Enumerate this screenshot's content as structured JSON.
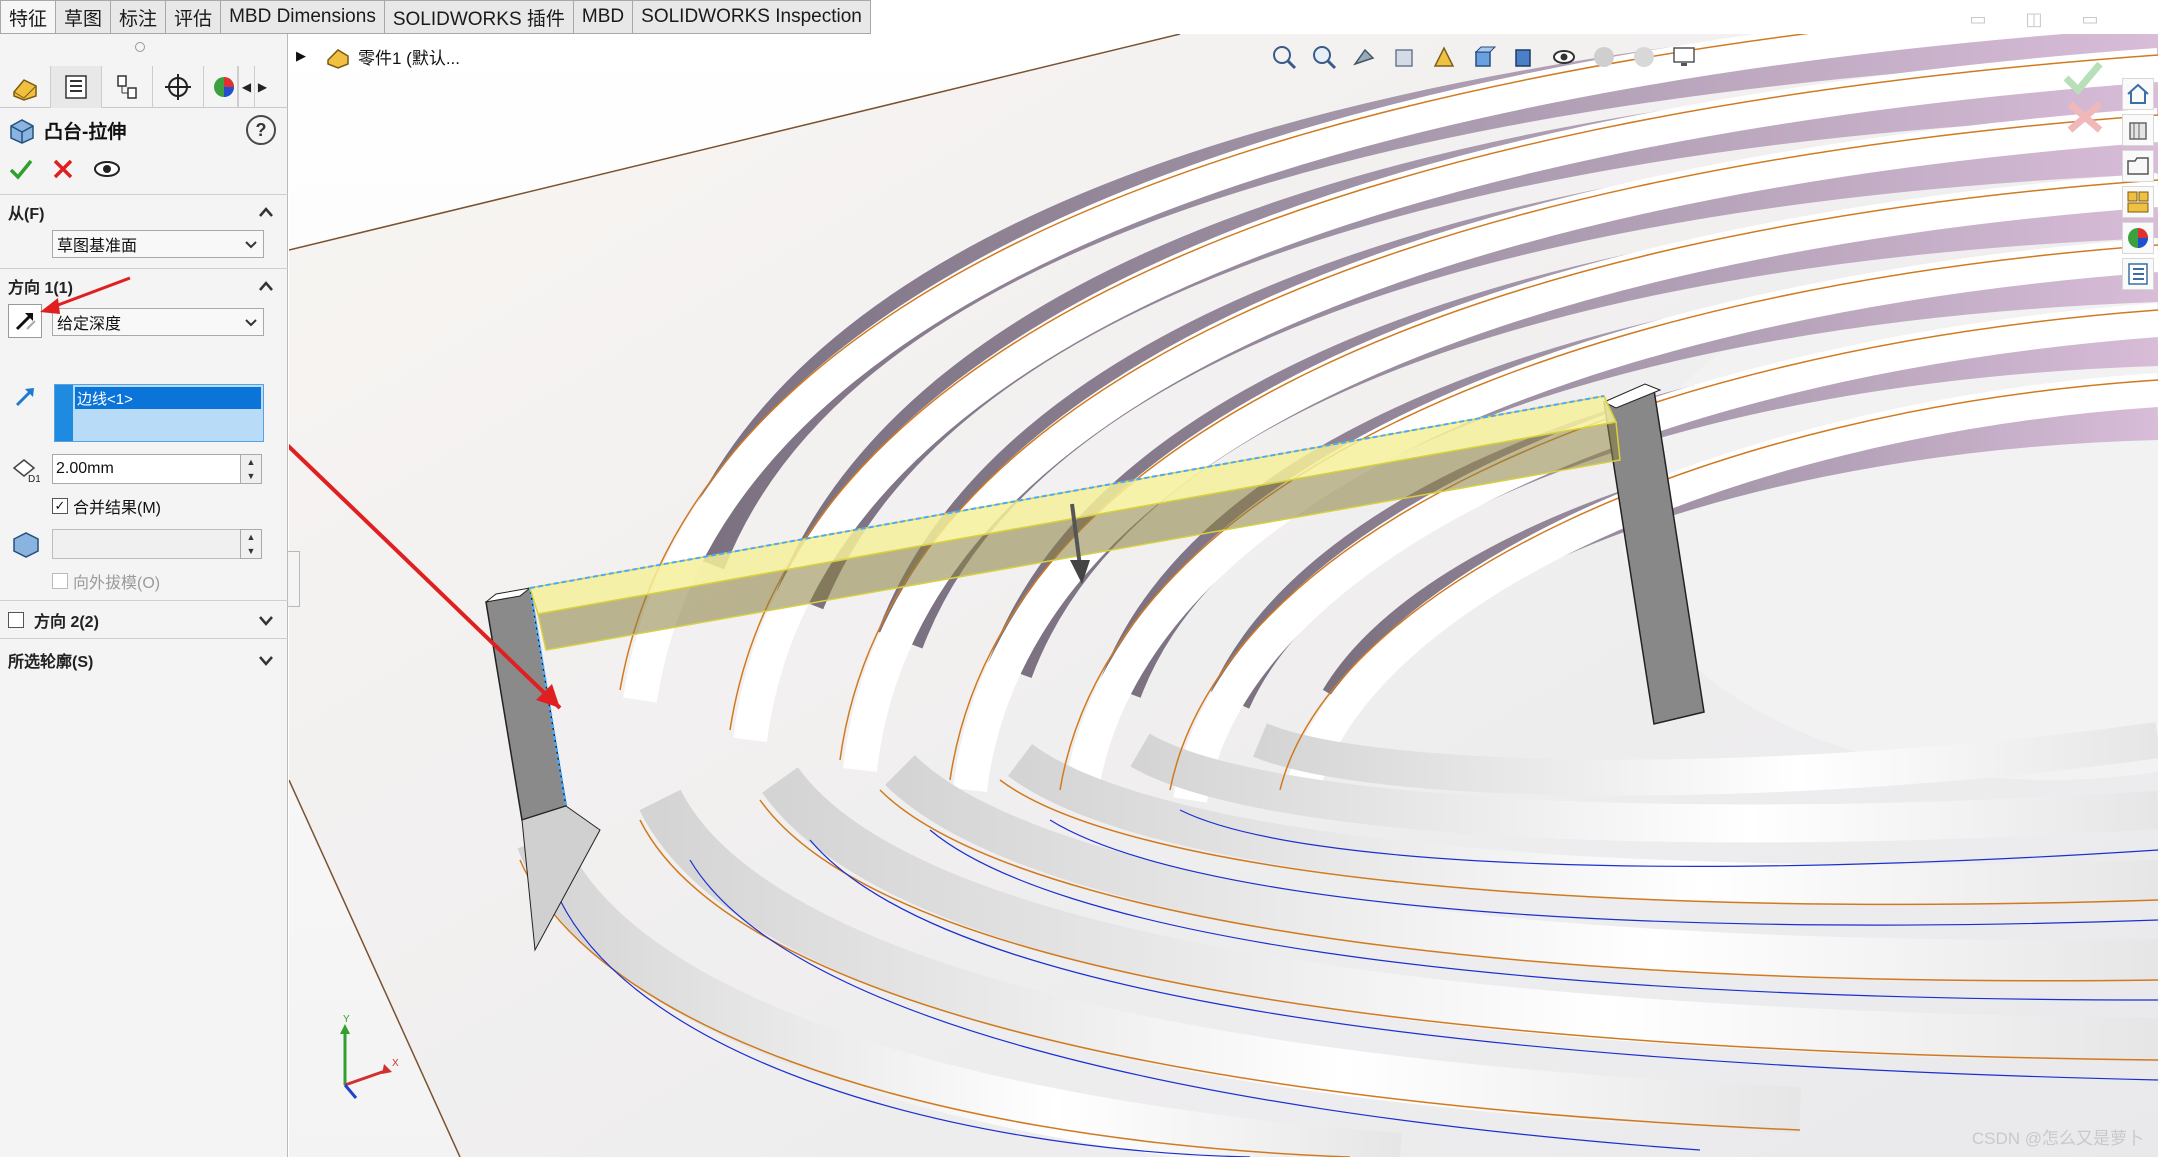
{
  "tabs": [
    "特征",
    "草图",
    "标注",
    "评估",
    "MBD Dimensions",
    "SOLIDWORKS 插件",
    "MBD",
    "SOLIDWORKS Inspection"
  ],
  "feature": {
    "title": "凸台-拉伸",
    "help": "?"
  },
  "sections": {
    "from": {
      "label": "从(F)",
      "value": "草图基准面"
    },
    "dir1": {
      "label": "方向 1(1)",
      "end_condition": "给定深度",
      "selection": "边线<1>",
      "depth": "2.00mm",
      "merge_label": "合并结果(M)",
      "draft_label": "向外拔模(O)"
    },
    "dir2": {
      "label": "方向 2(2)"
    },
    "contours": {
      "label": "所选轮廓(S)"
    }
  },
  "tree": {
    "item": "零件1 (默认..."
  },
  "watermark": "CSDN @怎么又是萝卜",
  "triad": {
    "x": "X",
    "y": "Y"
  },
  "colors": {
    "accent": "#0a74d8",
    "arrow": "#e02020",
    "ribbon_dark": "#8c8290",
    "ribbon_light": "#d8bcd8",
    "edge_orange": "#d07a20",
    "edge_blue": "#1c2fd0",
    "highlight_yellow": "#f4f09a"
  },
  "icons": {
    "tools": [
      "zoom-fit-icon",
      "zoom-area-icon",
      "previous-view-icon",
      "section-view-icon",
      "dynamic-annotation-icon",
      "view-orientation-icon",
      "display-style-icon",
      "hide-show-icon",
      "appearance-icon",
      "scene-icon",
      "monitor-icon"
    ],
    "side": [
      "home-icon",
      "design-library-icon",
      "file-explorer-icon",
      "view-palette-icon",
      "appearances-icon",
      "custom-properties-icon"
    ]
  }
}
